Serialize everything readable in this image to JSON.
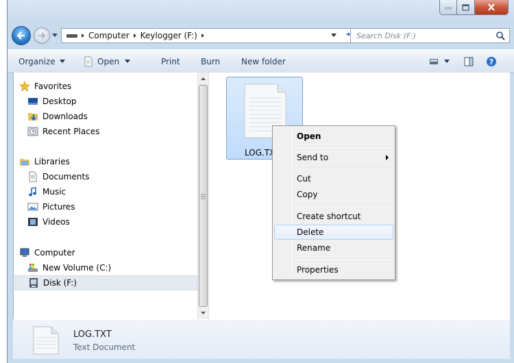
{
  "window": {
    "controls": {
      "minimize_icon": "minimize-icon",
      "maximize_icon": "maximize-icon",
      "close_icon": "close-icon"
    }
  },
  "address": {
    "crumbs": [
      "Computer",
      "Keylogger (F:)"
    ],
    "search_placeholder": "Search Disk (F:)"
  },
  "toolbar": {
    "organize": "Organize",
    "open": "Open",
    "print": "Print",
    "burn": "Burn",
    "new_folder": "New folder"
  },
  "nav": {
    "favorites": {
      "label": "Favorites",
      "items": [
        "Desktop",
        "Downloads",
        "Recent Places"
      ]
    },
    "libraries": {
      "label": "Libraries",
      "items": [
        "Documents",
        "Music",
        "Pictures",
        "Videos"
      ]
    },
    "computer": {
      "label": "Computer",
      "items": [
        "New Volume (C:)",
        "Disk (F:)"
      ]
    }
  },
  "files": [
    {
      "name": "LOG.TXT"
    }
  ],
  "context_menu": {
    "open": "Open",
    "send_to": "Send to",
    "cut": "Cut",
    "copy": "Copy",
    "create_shortcut": "Create shortcut",
    "delete": "Delete",
    "rename": "Rename",
    "properties": "Properties"
  },
  "details": {
    "name": "LOG.TXT",
    "type": "Text Document"
  },
  "colors": {
    "selection": "#c1dcfc",
    "accent": "#1e395b",
    "close_button": "#c75a3f"
  }
}
